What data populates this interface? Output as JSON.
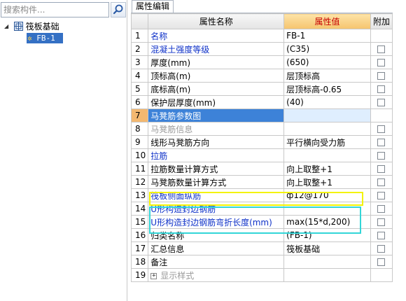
{
  "search": {
    "placeholder": "搜索构件..."
  },
  "tree": {
    "root_label": "筏板基础",
    "child_label": "FB-1"
  },
  "tab": {
    "label": "属性编辑"
  },
  "table": {
    "headers": [
      "属性名称",
      "属性值",
      "附加"
    ],
    "rows": [
      {
        "num": "1",
        "name": "名称",
        "value": "FB-1",
        "style": "blue",
        "check": false
      },
      {
        "num": "2",
        "name": "混凝土强度等级",
        "value": "(C35)",
        "style": "blue",
        "check": true
      },
      {
        "num": "3",
        "name": "厚度(mm)",
        "value": "(650)",
        "style": "normal",
        "check": true
      },
      {
        "num": "4",
        "name": "顶标高(m)",
        "value": "层顶标高",
        "style": "normal",
        "check": true
      },
      {
        "num": "5",
        "name": "底标高(m)",
        "value": "层顶标高-0.65",
        "style": "normal",
        "check": true
      },
      {
        "num": "6",
        "name": "保护层厚度(mm)",
        "value": "(40)",
        "style": "normal",
        "check": true
      },
      {
        "num": "7",
        "name": "马凳筋参数图",
        "value": "",
        "style": "selected",
        "check": false
      },
      {
        "num": "8",
        "name": "马凳筋信息",
        "value": "",
        "style": "gray",
        "check": true
      },
      {
        "num": "9",
        "name": "线形马凳筋方向",
        "value": "平行横向受力筋",
        "style": "normal",
        "check": true
      },
      {
        "num": "10",
        "name": "拉筋",
        "value": "",
        "style": "blue",
        "check": true
      },
      {
        "num": "11",
        "name": "拉筋数量计算方式",
        "value": "向上取整+1",
        "style": "normal",
        "check": true
      },
      {
        "num": "12",
        "name": "马凳筋数量计算方式",
        "value": "向上取整+1",
        "style": "normal",
        "check": true
      },
      {
        "num": "13",
        "name": "筏板侧面纵筋",
        "value": "ф12@170",
        "style": "blue",
        "check": true
      },
      {
        "num": "14",
        "name": "U形构造封边钢筋",
        "value": "",
        "style": "blue",
        "check": true
      },
      {
        "num": "15",
        "name": "U形构造封边钢筋弯折长度(mm)",
        "value": "max(15*d,200)",
        "style": "blue",
        "check": true
      },
      {
        "num": "16",
        "name": "归类名称",
        "value": "(FB-1)",
        "style": "normal",
        "check": true
      },
      {
        "num": "17",
        "name": "汇总信息",
        "value": "筏板基础",
        "style": "normal",
        "check": true
      },
      {
        "num": "18",
        "name": "备注",
        "value": "",
        "style": "normal",
        "check": true
      },
      {
        "num": "19",
        "name": "显示样式",
        "value": "",
        "style": "gray-expand",
        "check": false
      }
    ]
  },
  "colors": {
    "selection": "#3d82d8",
    "link_text": "#0e31c8",
    "header_value_bg": "#f5c46e",
    "highlight_yellow": "#f3f300",
    "highlight_cyan": "#33d6d8"
  }
}
